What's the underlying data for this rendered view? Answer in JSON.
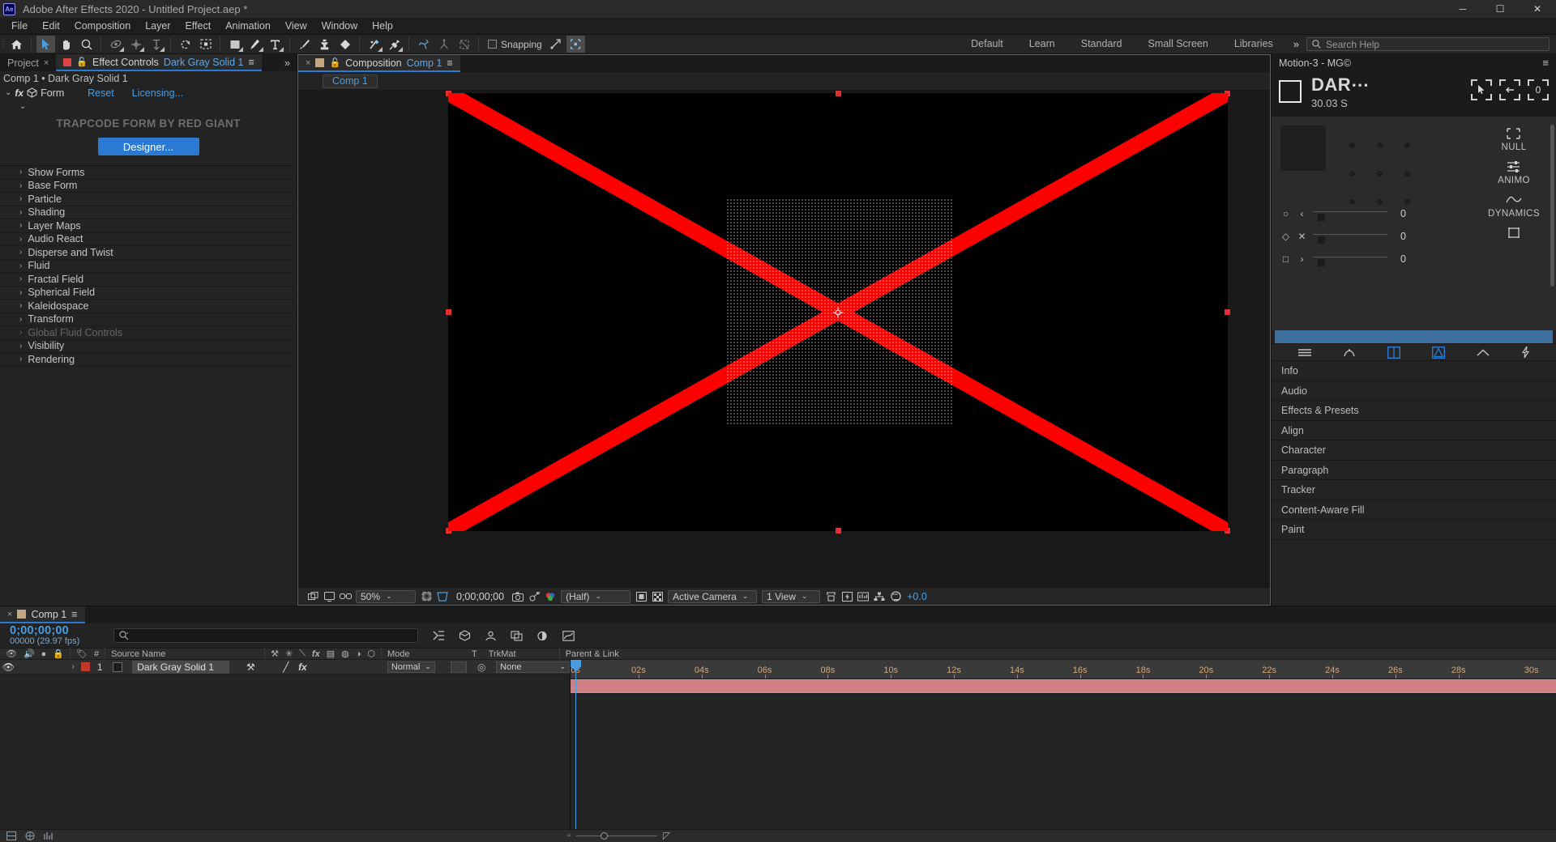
{
  "titlebar": {
    "logo": "Ae",
    "title": "Adobe After Effects 2020 - Untitled Project.aep *",
    "minimize": "─",
    "maximize": "☐",
    "close": "✕"
  },
  "menubar": {
    "items": [
      "File",
      "Edit",
      "Composition",
      "Layer",
      "Effect",
      "Animation",
      "View",
      "Window",
      "Help"
    ]
  },
  "toolbar": {
    "snapping_label": "Snapping",
    "workspaces": [
      "Default",
      "Learn",
      "Standard",
      "Small Screen",
      "Libraries"
    ],
    "more": "»",
    "search_help": "Search Help"
  },
  "effect_controls": {
    "tab_project": "Project",
    "tab_close": "×",
    "tab_title": "Effect Controls",
    "tab_subject": "Dark Gray Solid 1",
    "breadcrumb": "Comp 1 • Dark Gray Solid 1",
    "fx_label": "fx",
    "effect_name": "Form",
    "reset": "Reset",
    "licensing": "Licensing...",
    "brand": "TRAPCODE FORM BY RED GIANT",
    "designer_button": "Designer...",
    "properties": [
      {
        "label": "Show Forms",
        "disabled": false
      },
      {
        "label": "Base Form",
        "disabled": false
      },
      {
        "label": "Particle",
        "disabled": false
      },
      {
        "label": "Shading",
        "disabled": false
      },
      {
        "label": "Layer Maps",
        "disabled": false
      },
      {
        "label": "Audio React",
        "disabled": false
      },
      {
        "label": "Disperse and Twist",
        "disabled": false
      },
      {
        "label": "Fluid",
        "disabled": false
      },
      {
        "label": "Fractal Field",
        "disabled": false
      },
      {
        "label": "Spherical Field",
        "disabled": false
      },
      {
        "label": "Kaleidospace",
        "disabled": false
      },
      {
        "label": "Transform",
        "disabled": false
      },
      {
        "label": "Global Fluid Controls",
        "disabled": true
      },
      {
        "label": "Visibility",
        "disabled": false
      },
      {
        "label": "Rendering",
        "disabled": false
      }
    ]
  },
  "composition": {
    "tab_close": "×",
    "tab_label": "Composition",
    "tab_name": "Comp 1",
    "comp_tab": "Comp 1",
    "toolbar": {
      "zoom": "50%",
      "timecode": "0;00;00;00",
      "resolution": "(Half)",
      "camera": "Active Camera",
      "views": "1 View",
      "exposure": "+0.0"
    }
  },
  "right_panel": {
    "title": "Motion-3 - MG©",
    "burger": "≡",
    "dar": "DAR⋯",
    "duration": "30.03 S",
    "icon_zero": "0",
    "sliders": [
      {
        "value": "0"
      },
      {
        "value": "0"
      },
      {
        "value": "0"
      }
    ],
    "buttons": [
      {
        "label": "NULL",
        "icon": "null-bracket-icon"
      },
      {
        "label": "ANIMO",
        "icon": "animo-slider-icon"
      },
      {
        "label": "DYNAMICS",
        "icon": "dynamics-wave-icon"
      }
    ],
    "panels": [
      "Info",
      "Audio",
      "Effects & Presets",
      "Align",
      "Character",
      "Paragraph",
      "Tracker",
      "Content-Aware Fill",
      "Paint"
    ]
  },
  "timeline": {
    "tab_close": "×",
    "tab_name": "Comp 1",
    "burger": "≡",
    "timecode": "0;00;00;00",
    "frames": "00000 (29.97 fps)",
    "search_placeholder": "",
    "columns": {
      "source_name": "Source Name",
      "hash": "#",
      "mode": "Mode",
      "t": "T",
      "trkmat": "TrkMat",
      "parent_link": "Parent & Link"
    },
    "layers": [
      {
        "index": "1",
        "name": "Dark Gray Solid 1",
        "mode": "Normal",
        "parent": "None",
        "color": "#c0392b"
      }
    ],
    "ruler_ticks": [
      "0s",
      "02s",
      "04s",
      "06s",
      "08s",
      "10s",
      "12s",
      "14s",
      "16s",
      "18s",
      "20s",
      "22s",
      "24s",
      "26s",
      "28s",
      "30s"
    ]
  }
}
